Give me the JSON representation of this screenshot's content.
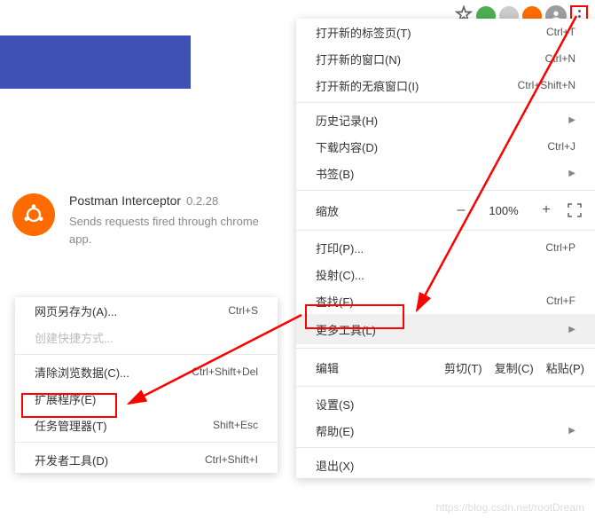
{
  "toolbar": {
    "star": "☆"
  },
  "extension": {
    "title": "Postman Interceptor",
    "version": "0.2.28",
    "description": "Sends requests fired through chrome app."
  },
  "primaryMenu": {
    "newTab": {
      "label": "打开新的标签页(T)",
      "shortcut": "Ctrl+T"
    },
    "newWindow": {
      "label": "打开新的窗口(N)",
      "shortcut": "Ctrl+N"
    },
    "incognito": {
      "label": "打开新的无痕窗口(I)",
      "shortcut": "Ctrl+Shift+N"
    },
    "history": {
      "label": "历史记录(H)"
    },
    "downloads": {
      "label": "下载内容(D)",
      "shortcut": "Ctrl+J"
    },
    "bookmarks": {
      "label": "书签(B)"
    },
    "zoom": {
      "label": "缩放",
      "value": "100%",
      "minus": "–",
      "plus": "+"
    },
    "print": {
      "label": "打印(P)...",
      "shortcut": "Ctrl+P"
    },
    "cast": {
      "label": "投射(C)..."
    },
    "find": {
      "label": "查找(F)...",
      "shortcut": "Ctrl+F"
    },
    "moreTools": {
      "label": "更多工具(L)"
    },
    "edit": {
      "label": "编辑",
      "cut": "剪切(T)",
      "copy": "复制(C)",
      "paste": "粘贴(P)"
    },
    "settings": {
      "label": "设置(S)"
    },
    "help": {
      "label": "帮助(E)"
    },
    "exit": {
      "label": "退出(X)"
    }
  },
  "subMenu": {
    "saveAs": {
      "label": "网页另存为(A)...",
      "shortcut": "Ctrl+S"
    },
    "createShortcut": {
      "label": "创建快捷方式..."
    },
    "clearData": {
      "label": "清除浏览数据(C)...",
      "shortcut": "Ctrl+Shift+Del"
    },
    "extensions": {
      "label": "扩展程序(E)"
    },
    "taskManager": {
      "label": "任务管理器(T)",
      "shortcut": "Shift+Esc"
    },
    "devTools": {
      "label": "开发者工具(D)",
      "shortcut": "Ctrl+Shift+I"
    }
  },
  "watermark": "https://blog.csdn.net/rootDream"
}
